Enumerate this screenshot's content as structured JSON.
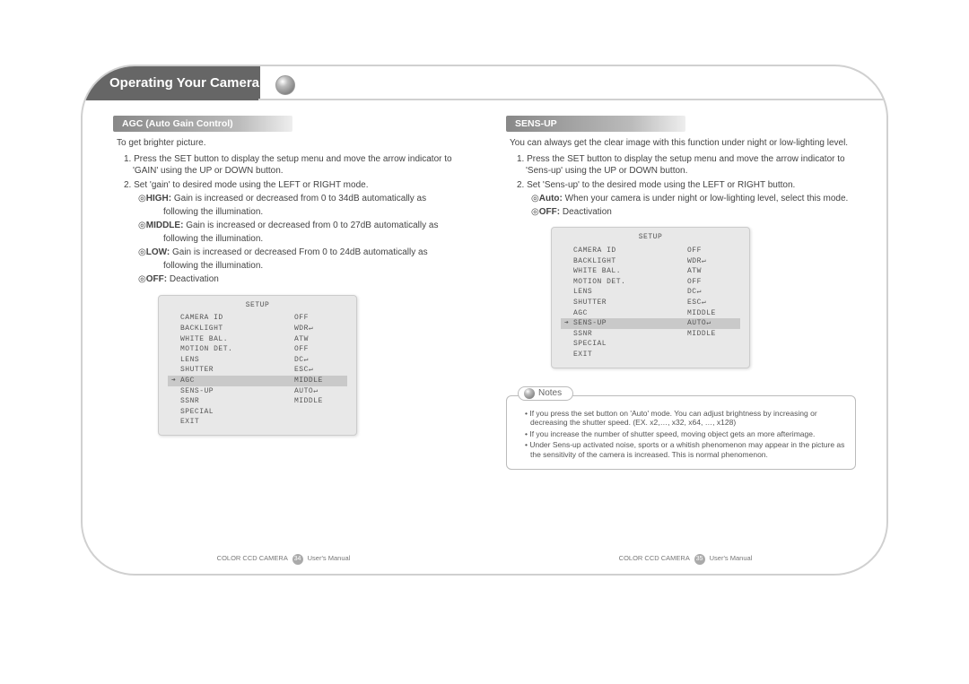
{
  "header": {
    "title": "Operating Your Camera"
  },
  "left": {
    "section_title": "AGC  (Auto Gain Control)",
    "intro": "To get brighter picture.",
    "steps": [
      "1. Press the SET button to display the setup menu and move the arrow indicator to 'GAIN' using the UP or DOWN button.",
      "2. Set 'gain' to desired mode using the LEFT or RIGHT mode."
    ],
    "modes": [
      {
        "label": "HIGH:",
        "text": "Gain is increased or decreased from 0 to 34dB automatically as",
        "cont": "following the illumination."
      },
      {
        "label": "MIDDLE:",
        "text": "Gain is increased or decreased from 0 to 27dB automatically as",
        "cont": "following the illumination."
      },
      {
        "label": "LOW:",
        "text": "Gain is increased or decreased From 0 to 24dB automatically as",
        "cont": "following the illumination."
      },
      {
        "label": "OFF:",
        "text": "Deactivation",
        "cont": ""
      }
    ],
    "setup": {
      "title": "SETUP",
      "rows": [
        {
          "arrow": "",
          "label": "CAMERA ID",
          "value": "OFF",
          "hl": false
        },
        {
          "arrow": "",
          "label": "BACKLIGHT",
          "value": "WDR↵",
          "hl": false
        },
        {
          "arrow": "",
          "label": "WHITE BAL.",
          "value": "ATW",
          "hl": false
        },
        {
          "arrow": "",
          "label": "MOTION DET.",
          "value": "OFF",
          "hl": false
        },
        {
          "arrow": "",
          "label": "LENS",
          "value": "DC↵",
          "hl": false
        },
        {
          "arrow": "",
          "label": "SHUTTER",
          "value": "ESC↵",
          "hl": false
        },
        {
          "arrow": "➔",
          "label": "AGC",
          "value": "MIDDLE",
          "hl": true
        },
        {
          "arrow": "",
          "label": "SENS-UP",
          "value": "AUTO↵",
          "hl": false
        },
        {
          "arrow": "",
          "label": "SSNR",
          "value": "MIDDLE",
          "hl": false
        },
        {
          "arrow": "",
          "label": "SPECIAL",
          "value": "",
          "hl": false
        },
        {
          "arrow": "",
          "label": "EXIT",
          "value": "",
          "hl": false
        }
      ]
    }
  },
  "right": {
    "section_title": "SENS-UP",
    "intro": "You can always get the clear image with this function under night or low-lighting level.",
    "steps": [
      "1. Press the SET button to display the setup menu and move the arrow indicator to 'Sens-up' using the UP or DOWN button.",
      "2. Set 'Sens-up' to the desired mode using the LEFT or RIGHT button."
    ],
    "modes": [
      {
        "label": "Auto:",
        "text": "When your camera is under night or low-lighting level, select this mode.",
        "cont": ""
      },
      {
        "label": "OFF:",
        "text": "Deactivation",
        "cont": ""
      }
    ],
    "setup": {
      "title": "SETUP",
      "rows": [
        {
          "arrow": "",
          "label": "CAMERA ID",
          "value": "OFF",
          "hl": false
        },
        {
          "arrow": "",
          "label": "BACKLIGHT",
          "value": "WDR↵",
          "hl": false
        },
        {
          "arrow": "",
          "label": "WHITE BAL.",
          "value": "ATW",
          "hl": false
        },
        {
          "arrow": "",
          "label": "MOTION DET.",
          "value": "OFF",
          "hl": false
        },
        {
          "arrow": "",
          "label": "LENS",
          "value": "DC↵",
          "hl": false
        },
        {
          "arrow": "",
          "label": "SHUTTER",
          "value": "ESC↵",
          "hl": false
        },
        {
          "arrow": "",
          "label": "AGC",
          "value": "MIDDLE",
          "hl": false
        },
        {
          "arrow": "➔",
          "label": "SENS-UP",
          "value": "AUTO↵",
          "hl": true
        },
        {
          "arrow": "",
          "label": "SSNR",
          "value": "MIDDLE",
          "hl": false
        },
        {
          "arrow": "",
          "label": "SPECIAL",
          "value": "",
          "hl": false
        },
        {
          "arrow": "",
          "label": "EXIT",
          "value": "",
          "hl": false
        }
      ]
    },
    "notes_label": "Notes",
    "notes": [
      "If you press the set button on 'Auto' mode. You can adjust brightness by increasing or decreasing the shutter speed. (EX. x2,…, x32, x64, …, x128)",
      "If you increase the number of shutter speed, moving object gets an more afterimage.",
      "Under Sens-up activated noise, sports or a whitish phenomenon may appear in the picture as the sensitivity of the camera is increased. This is normal phenomenon."
    ]
  },
  "footer": {
    "product": "COLOR CCD CAMERA",
    "manual": "User's Manual",
    "page_left": "34",
    "page_right": "35"
  }
}
